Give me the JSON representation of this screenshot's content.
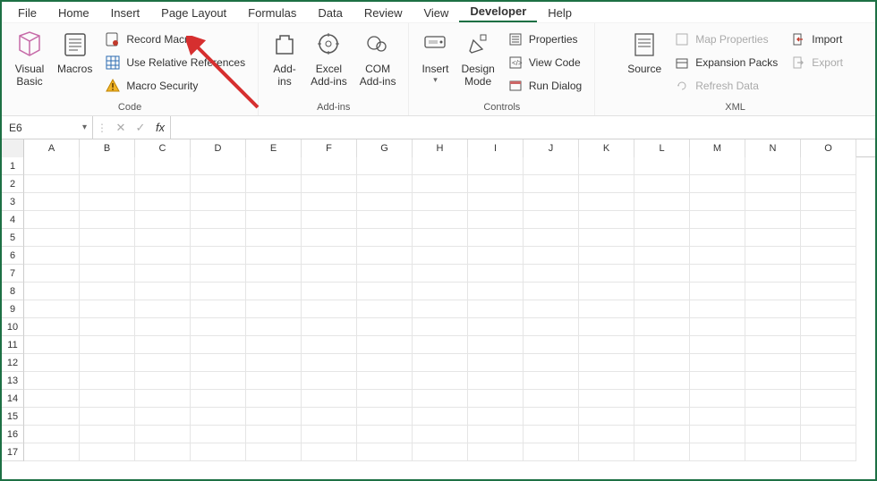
{
  "tabs": [
    "File",
    "Home",
    "Insert",
    "Page Layout",
    "Formulas",
    "Data",
    "Review",
    "View",
    "Developer",
    "Help"
  ],
  "active_tab": "Developer",
  "ribbon": {
    "code": {
      "label": "Code",
      "visual_basic": "Visual\nBasic",
      "macros": "Macros",
      "record_macro": "Record Macro",
      "use_relative": "Use Relative References",
      "macro_security": "Macro Security"
    },
    "addins": {
      "label": "Add-ins",
      "addins": "Add-\nins",
      "excel_addins": "Excel\nAdd-ins",
      "com_addins": "COM\nAdd-ins"
    },
    "controls": {
      "label": "Controls",
      "insert": "Insert",
      "design_mode": "Design\nMode",
      "properties": "Properties",
      "view_code": "View Code",
      "run_dialog": "Run Dialog"
    },
    "xml": {
      "label": "XML",
      "source": "Source",
      "map_properties": "Map Properties",
      "expansion_packs": "Expansion Packs",
      "refresh_data": "Refresh Data",
      "import": "Import",
      "export": "Export"
    }
  },
  "formula_bar": {
    "name_box": "E6",
    "cancel": "✕",
    "enter": "✓",
    "fx": "fx",
    "formula": ""
  },
  "columns": [
    "A",
    "B",
    "C",
    "D",
    "E",
    "F",
    "G",
    "H",
    "I",
    "J",
    "K",
    "L",
    "M",
    "N",
    "O"
  ],
  "rows": [
    1,
    2,
    3,
    4,
    5,
    6,
    7,
    8,
    9,
    10,
    11,
    12,
    13,
    14,
    15,
    16,
    17
  ]
}
